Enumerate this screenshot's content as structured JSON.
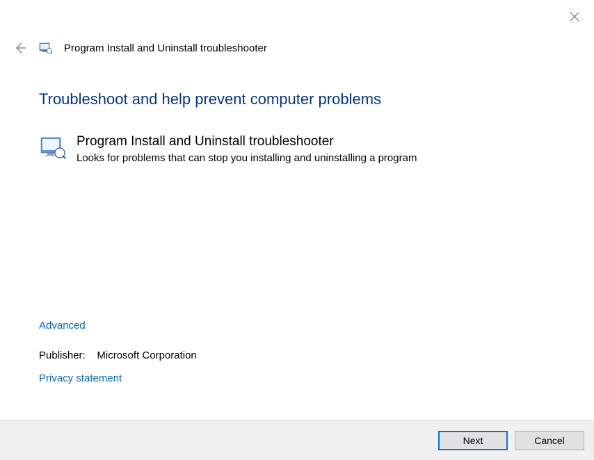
{
  "header": {
    "title": "Program Install and Uninstall troubleshooter"
  },
  "main": {
    "heading": "Troubleshoot and help prevent computer problems",
    "item": {
      "title": "Program Install and Uninstall troubleshooter",
      "description": "Looks for problems that can stop you installing and uninstalling a program"
    }
  },
  "links": {
    "advanced": "Advanced",
    "publisher_label": "Publisher:",
    "publisher_value": "Microsoft Corporation",
    "privacy": "Privacy statement"
  },
  "footer": {
    "next": "Next",
    "cancel": "Cancel"
  }
}
